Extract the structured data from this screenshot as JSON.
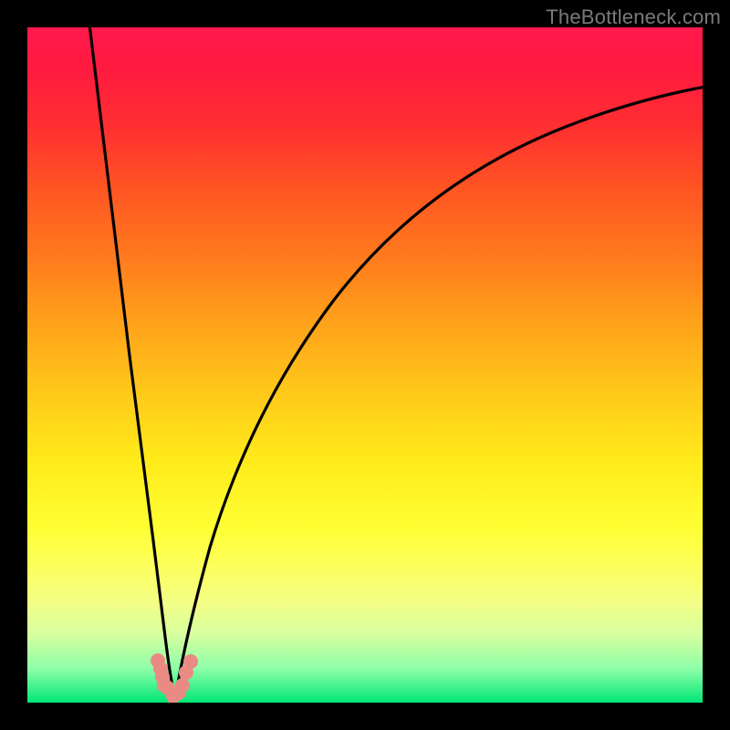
{
  "watermark": {
    "text": "TheBottleneck.com"
  },
  "colors": {
    "frame": "#000000",
    "curve_stroke": "#000000",
    "marker_fill": "#e98b84",
    "watermark_text": "#7a7a7a",
    "gradient_top": "#ff1a4d",
    "gradient_bottom": "#00e676"
  },
  "chart_data": {
    "type": "line",
    "title": "",
    "xlabel": "",
    "ylabel": "",
    "xlim": [
      0,
      100
    ],
    "ylim": [
      0,
      100
    ],
    "grid": false,
    "legend": false,
    "note": "Axes are unlabeled; x and y values are normalized 0–100 estimated from pixel positions. Minimum of the V-shaped curve sits near x≈21, y≈0.",
    "series": [
      {
        "name": "left-branch",
        "x": [
          8.9,
          10,
          12,
          14,
          16,
          18,
          20,
          21.5
        ],
        "y": [
          100,
          89,
          70,
          52,
          36,
          22,
          10,
          1
        ]
      },
      {
        "name": "right-branch",
        "x": [
          21.5,
          23,
          25,
          28,
          32,
          37,
          43,
          50,
          58,
          67,
          77,
          88,
          100
        ],
        "y": [
          1,
          8,
          17,
          28,
          39,
          49,
          58,
          66,
          72,
          77,
          82,
          86,
          89
        ]
      },
      {
        "name": "markers",
        "kind": "scatter",
        "x": [
          19.3,
          19.7,
          20.0,
          20.8,
          21.6,
          23.0,
          23.5,
          24.2
        ],
        "y": [
          6.2,
          5.0,
          3.8,
          2.2,
          1.0,
          2.6,
          4.4,
          6.0
        ]
      }
    ]
  }
}
